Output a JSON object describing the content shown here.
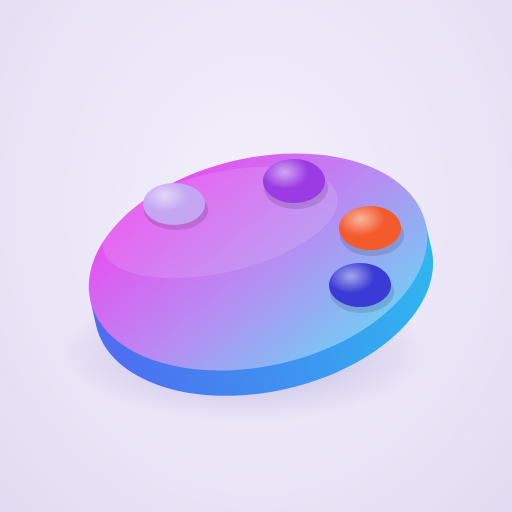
{
  "scene": {
    "subject": "palette-icon",
    "colors": {
      "background": "#ede8f7",
      "disc_top_start": "#e94cf0",
      "disc_top_mid": "#b98af2",
      "disc_top_end": "#6fd0f4",
      "disc_side_start": "#4e6cf0",
      "disc_side_end": "#2fb7f0",
      "shadow": "#7b6dbf"
    },
    "paint_dots": [
      {
        "name": "lavender-paint-dot",
        "color": "#c4a6f2"
      },
      {
        "name": "purple-paint-dot",
        "color": "#9b3be3"
      },
      {
        "name": "orange-paint-dot",
        "color": "#f35a2c"
      },
      {
        "name": "blue-paint-dot",
        "color": "#3a3ad6"
      }
    ]
  }
}
